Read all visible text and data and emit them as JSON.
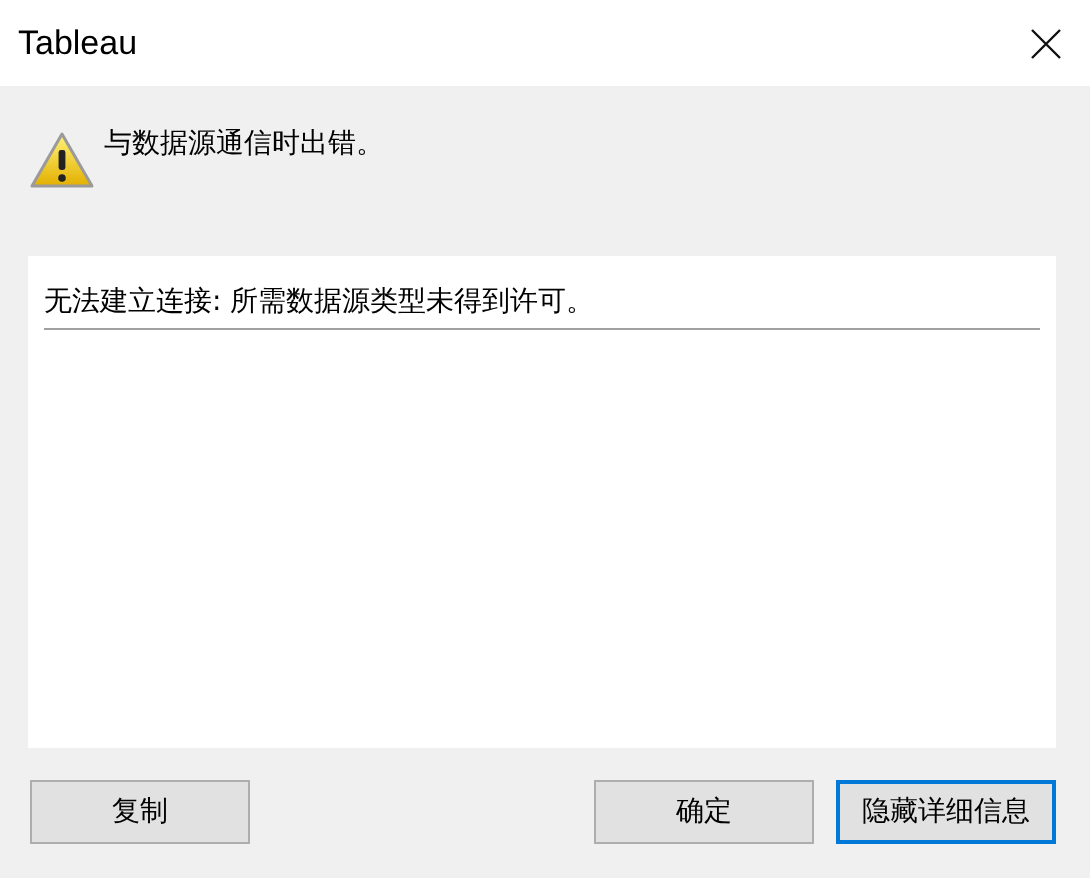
{
  "window": {
    "title": "Tableau"
  },
  "message": "与数据源通信时出错。",
  "details": [
    "无法建立连接: 所需数据源类型未得到许可。"
  ],
  "left_buttons": [
    {
      "label": "复制",
      "focused": false
    }
  ],
  "right_buttons": [
    {
      "label": "确定",
      "focused": false
    },
    {
      "label": "隐藏详细信息",
      "focused": true
    }
  ]
}
